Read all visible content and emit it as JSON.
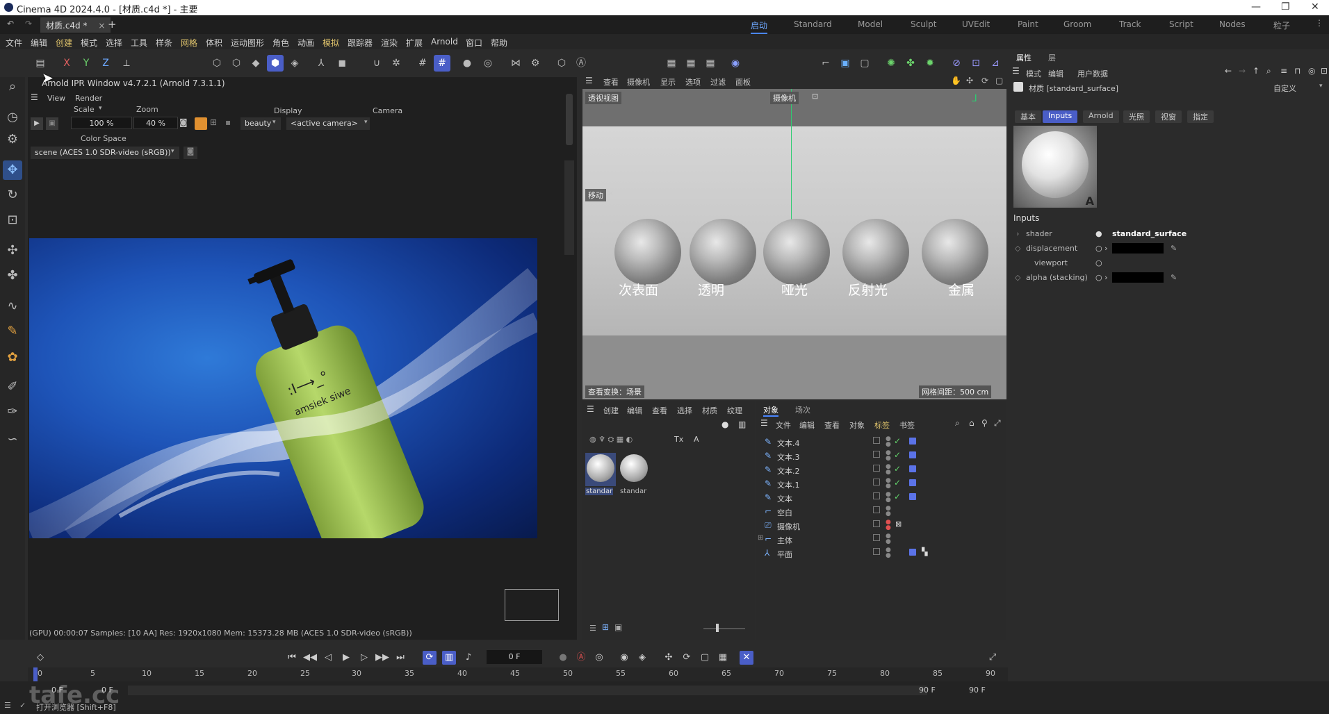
{
  "window": {
    "title": "Cinema 4D 2024.4.0 - [材质.c4d *] - 主要"
  },
  "doc_tab": {
    "label": "材质.c4d *"
  },
  "layouts": [
    "启动",
    "Standard",
    "Model",
    "Sculpt",
    "UVEdit",
    "Paint",
    "Groom",
    "Track",
    "Script",
    "Nodes",
    "粒子"
  ],
  "menu": [
    "文件",
    "编辑",
    "创建",
    "模式",
    "选择",
    "工具",
    "样条",
    "网格",
    "体积",
    "运动图形",
    "角色",
    "动画",
    "模拟",
    "跟踪器",
    "渲染",
    "扩展",
    "Arnold",
    "窗口",
    "帮助"
  ],
  "axis": {
    "x": "X",
    "y": "Y",
    "z": "Z"
  },
  "ipr": {
    "title": "Arnold IPR Window v4.7.2.1 (Arnold 7.3.1.1)",
    "menus": {
      "view": "View",
      "render": "Render"
    },
    "scale_label": "Scale",
    "scale_value": "100 %",
    "zoom_label": "Zoom",
    "zoom_value": "40 %",
    "display_label": "Display",
    "display_value": "beauty",
    "camera_label": "Camera",
    "camera_value": "<active camera>",
    "colorspace_label": "Color Space",
    "colorspace_value": "scene (ACES 1.0 SDR-video (sRGB))",
    "bottle_brand": "amsiek siwe",
    "bottle_logo": ":I⟶_°",
    "status": "(GPU) 00:00:07  Samples: [10 AA]  Res: 1920x1080  Mem: 15373.28 MB  (ACES 1.0 SDR-video (sRGB))"
  },
  "viewport": {
    "menus": [
      "查看",
      "摄像机",
      "显示",
      "选项",
      "过滤",
      "面板"
    ],
    "view_name": "透视视图",
    "camera_badge": "摄像机",
    "move_badge": "移动",
    "labels": [
      "次表面",
      "透明",
      "哑光",
      "反射光",
      "金属"
    ],
    "footer_left": "查看变换：场景",
    "footer_right": "网格间距：500 cm"
  },
  "material_manager": {
    "menus": [
      "创建",
      "编辑",
      "查看",
      "选择",
      "材质",
      "纹理"
    ],
    "materials": [
      "standar",
      "standar"
    ]
  },
  "object_manager": {
    "tabs": [
      "对象",
      "场次"
    ],
    "menus": [
      "文件",
      "编辑",
      "查看",
      "对象",
      "标签",
      "书签"
    ],
    "objects": [
      "文本.4",
      "文本.3",
      "文本.2",
      "文本.1",
      "文本",
      "空白",
      "摄像机",
      "主体",
      "平面"
    ]
  },
  "attributes": {
    "tabs": [
      "属性",
      "层"
    ],
    "menus": [
      "模式",
      "编辑",
      "用户数据"
    ],
    "material_name": "材质 [standard_surface]",
    "preset": "自定义",
    "subtabs": [
      "基本",
      "Inputs",
      "Arnold",
      "光照",
      "视窗",
      "指定"
    ],
    "section": "Inputs",
    "props": [
      {
        "name": "shader",
        "value": "standard_surface"
      },
      {
        "name": "displacement",
        "value": ""
      },
      {
        "name": "viewport",
        "value": ""
      },
      {
        "name": "alpha (stacking)",
        "value": ""
      }
    ]
  },
  "timeline": {
    "current_frame": "0 F",
    "ruler": [
      "0",
      "5",
      "10",
      "15",
      "20",
      "25",
      "30",
      "35",
      "40",
      "45",
      "50",
      "55",
      "60",
      "65",
      "70",
      "75",
      "80",
      "85",
      "90"
    ],
    "start_a": "0 F",
    "start_b": "0 F",
    "end_a": "90 F",
    "end_b": "90 F"
  },
  "statusbar": {
    "hint": "打开浏览器 [Shift+F8]"
  },
  "watermark": "tafe.cc",
  "colors": {
    "accent": "#4a5ec7",
    "render_bg": "#1e54b8",
    "bottle": "#a7cc5a"
  }
}
